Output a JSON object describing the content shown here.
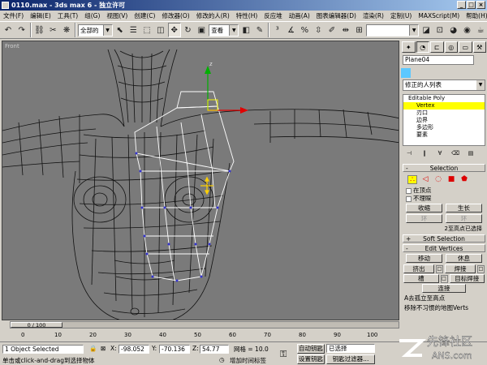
{
  "window": {
    "title": "0110.max - 3ds max 6 - 独立许可"
  },
  "menu": [
    "文件(F)",
    "编辑(E)",
    "工具(T)",
    "组(G)",
    "视图(V)",
    "创建(C)",
    "修改器(O)",
    "修改的人(R)",
    "特性(H)",
    "反应堆",
    "动画(A)",
    "图表编辑器(D)",
    "渲染(R)",
    "定制(U)",
    "MAXScript(M)",
    "帮助(H)"
  ],
  "toolbar": {
    "selection_filter": "全部的",
    "ref_coord": "查看",
    "named_sel": ""
  },
  "viewport": {
    "label": "Front"
  },
  "command_panel": {
    "object_name": "Plane04",
    "modifier_list": "修正的人列表",
    "stack": [
      {
        "label": "Editable Poly",
        "root": true
      },
      {
        "label": "Vertex",
        "selected": true
      },
      {
        "label": "刃口"
      },
      {
        "label": "边界"
      },
      {
        "label": "多边形"
      },
      {
        "label": "要素"
      }
    ],
    "selection_title": "Selection",
    "by_vertex": "在顶点",
    "ignore_backfacing": "不理睬",
    "shrink": "收缩",
    "grow": "生长",
    "ring": "环",
    "loop": "环",
    "selected_status": "2至高点已选择",
    "soft_selection_title": "Soft Selection",
    "edit_vertices_title": "Edit Vertices",
    "move": "移动",
    "rest": "休息",
    "extrude": "挤出",
    "weld": "焊接",
    "chamfer": "槽",
    "target_weld": "目标焊接",
    "connect": "连接",
    "remove_isolated": "A去孤立至高点",
    "remove_unused": "移除不习惯的地图Verts"
  },
  "timeline": {
    "frame_display": "0 / 100",
    "ticks": [
      "0",
      "10",
      "20",
      "30",
      "40",
      "50",
      "60",
      "70",
      "80",
      "90",
      "100"
    ]
  },
  "status": {
    "selection_count": "1 Object Selected",
    "prompt": "单击或click-and-drag到选择物体",
    "x_label": "X:",
    "x_value": "-98.052",
    "y_label": "Y:",
    "y_value": "-70.136",
    "z_label": "Z:",
    "z_value": "54.77",
    "grid": "网格 = 10.0",
    "add_time_tag": "增加时间标签",
    "auto_key": "自动钥匙",
    "set_key": "设置钥匙",
    "key_mode": "已选择",
    "key_filters": "钥匙过滤器..."
  },
  "watermark": {
    "text": "先锋社区",
    "domain": "ANS.com"
  },
  "colors": {
    "object_color": "#5cc8ff",
    "highlight": "#ffff00"
  }
}
